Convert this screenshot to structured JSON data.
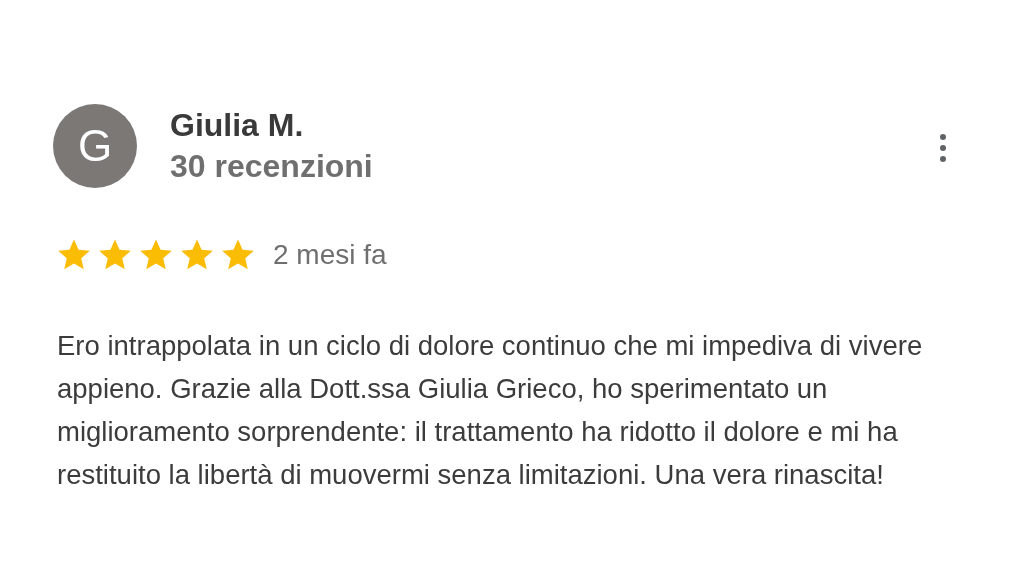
{
  "review": {
    "avatar_letter": "G",
    "author": "Giulia M.",
    "review_count": "30 recenzioni",
    "stars": 5,
    "time": "2 mesi fa",
    "text": "Ero intrappolata in un ciclo di dolore continuo che mi impediva di vivere appieno. Grazie alla Dott.ssa Giulia Grieco, ho sperimentato un miglioramento sorprendente: il trattamento ha ridotto il dolore e mi ha restituito la libertà di muovermi senza limitazioni. Una vera rinascita!"
  }
}
